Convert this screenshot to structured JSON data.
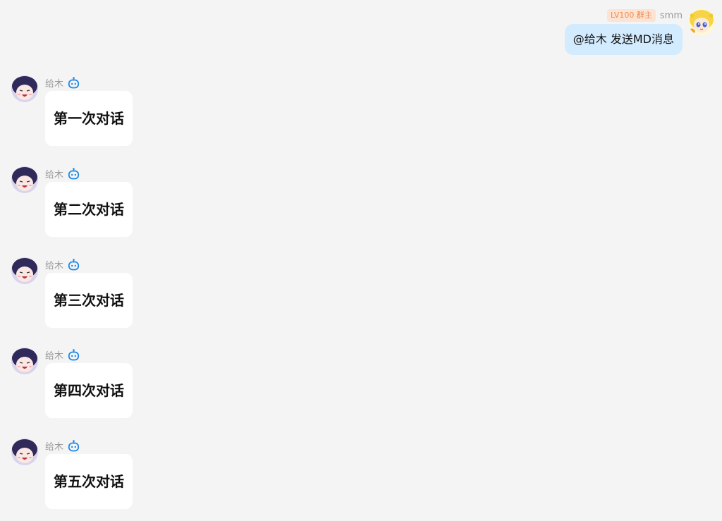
{
  "sender": {
    "badge": "LV100 群主",
    "name": "smm",
    "message": "@给木 发送MD消息",
    "avatar_icon": "blonde-anime-avatar-icon"
  },
  "bot": {
    "name": "给木",
    "bot_icon": "robot-icon",
    "avatar_icon": "dark-haired-anime-avatar-icon"
  },
  "replies": [
    {
      "text": "第一次对话"
    },
    {
      "text": "第二次对话"
    },
    {
      "text": "第三次对话"
    },
    {
      "text": "第四次对话"
    },
    {
      "text": "第五次对话"
    }
  ],
  "colors": {
    "background": "#f4f4f4",
    "outgoing_bubble": "#d2ebff",
    "incoming_bubble": "#ffffff",
    "badge_bg": "#fde3d3",
    "badge_text": "#f08a4b",
    "bot_icon": "#1e88e5"
  }
}
